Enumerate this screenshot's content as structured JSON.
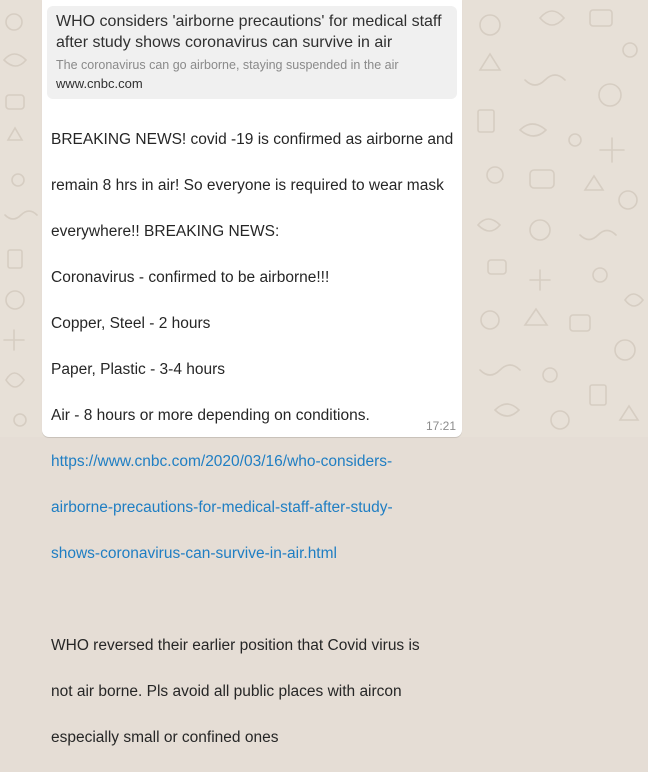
{
  "link_preview": {
    "title": "WHO considers 'airborne precautions' for medical staff after study shows coronavirus can survive in air",
    "description": "The coronavirus can go airborne, staying suspended in the air",
    "domain": "www.cnbc.com"
  },
  "message": {
    "lines": [
      "BREAKING NEWS! covid -19 is confirmed as airborne and",
      "remain 8 hrs in air! So everyone is required to wear mask",
      "everywhere!! BREAKING NEWS:",
      "Coronavirus - confirmed to be airborne!!!",
      "Copper, Steel - 2 hours",
      "Paper, Plastic - 3-4 hours",
      "Air - 8 hours or more depending on conditions."
    ],
    "link_lines": [
      "https://www.cnbc.com/2020/03/16/who-considers-",
      "airborne-precautions-for-medical-staff-after-study-",
      "shows-coronavirus-can-survive-in-air.html"
    ],
    "closing_lines": [
      "WHO reversed their earlier position that Covid virus is",
      "not air borne. Pls avoid all public places with aircon",
      "especially small or confined ones"
    ],
    "time": "17:21"
  },
  "colors": {
    "chat_background": "#e7e0d7",
    "bubble": "#ffffff",
    "preview_background": "#f0f0f0",
    "link": "#1f7ec3",
    "doodle": "#d8cfc4"
  }
}
